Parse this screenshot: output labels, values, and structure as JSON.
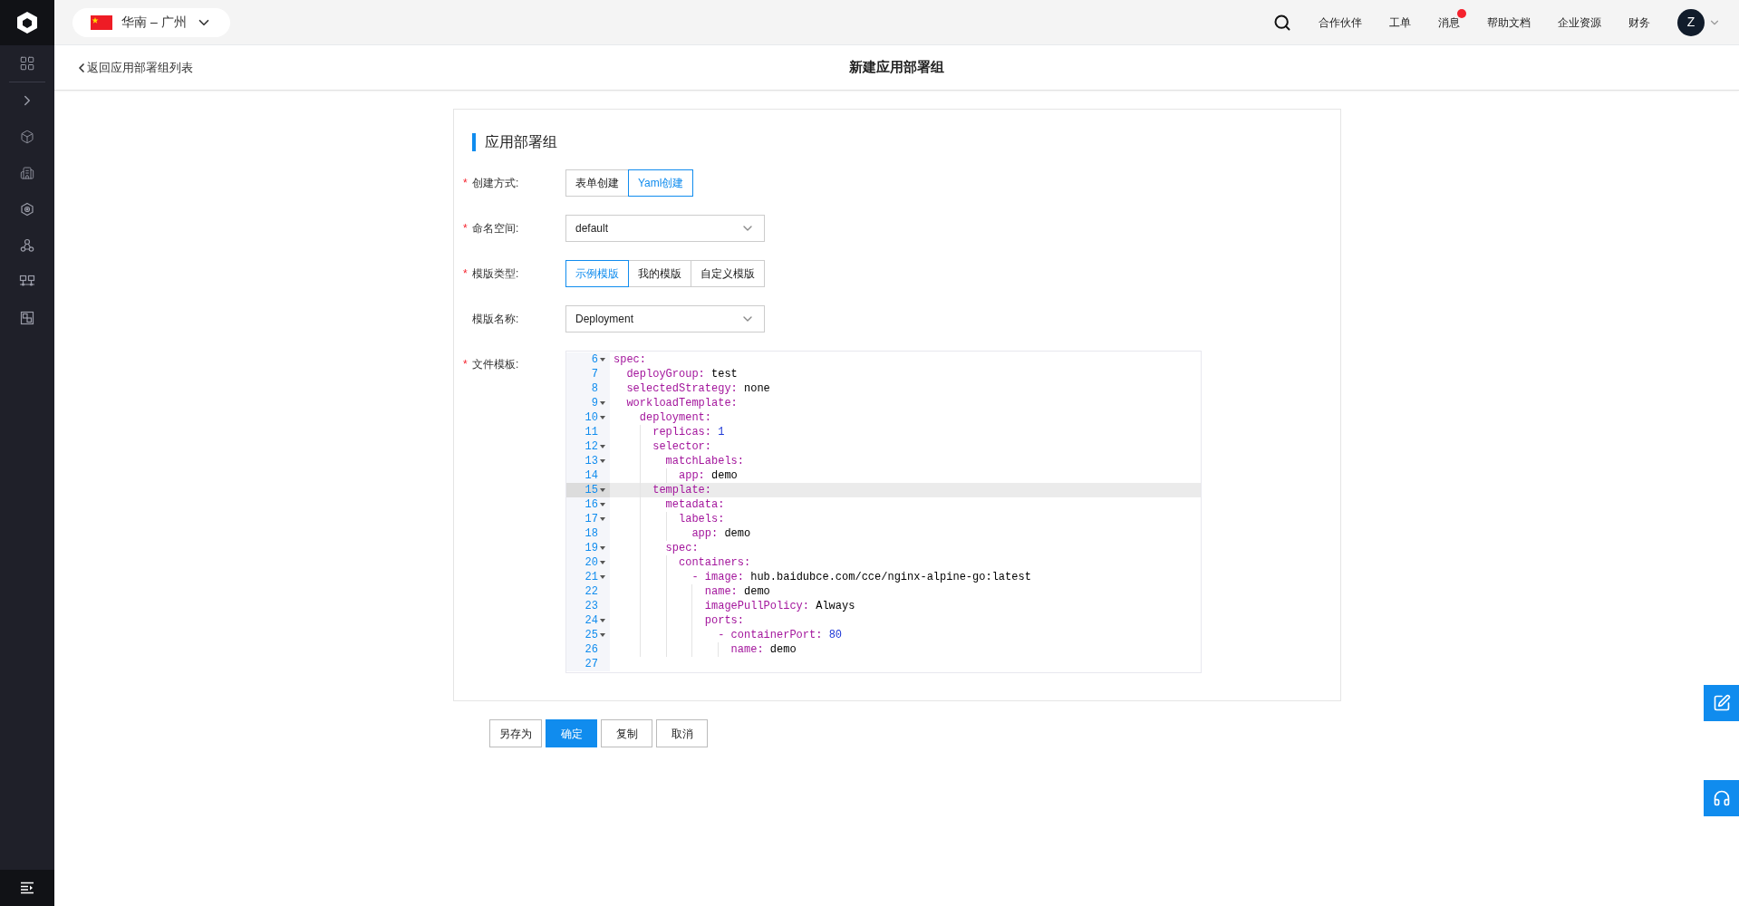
{
  "topbar": {
    "region": "华南 – 广州",
    "nav": [
      {
        "label": "合作伙伴",
        "badge": false
      },
      {
        "label": "工单",
        "badge": false
      },
      {
        "label": "消息",
        "badge": true
      },
      {
        "label": "帮助文档",
        "badge": false
      },
      {
        "label": "企业资源",
        "badge": false
      },
      {
        "label": "财务",
        "badge": false
      }
    ],
    "avatar": "Z"
  },
  "subheader": {
    "back_link": "返回应用部署组列表",
    "title": "新建应用部署组"
  },
  "card": {
    "title": "应用部署组",
    "fields": [
      {
        "kind": "segmented",
        "label": "创建方式:",
        "required_mark": "*",
        "options": [
          {
            "label": "表单创建",
            "selected": false
          },
          {
            "label": "Yaml创建",
            "selected": true
          }
        ]
      },
      {
        "kind": "select",
        "label": "命名空间:",
        "required_mark": "*",
        "value": "default"
      },
      {
        "kind": "segmented",
        "label": "模版类型:",
        "required_mark": "*",
        "options": [
          {
            "label": "示例模版",
            "selected": true
          },
          {
            "label": "我的模版",
            "selected": false
          },
          {
            "label": "自定义模版",
            "selected": false
          }
        ]
      },
      {
        "kind": "select",
        "label": "模版名称:",
        "value": "Deployment"
      },
      {
        "kind": "editor",
        "label": "文件模板:",
        "required_mark": "*",
        "lines": [
          {
            "number": "6",
            "fold": true,
            "key": "spec:",
            "children": [
              {
                "number": "7",
                "fold": false,
                "key": "deployGroup:",
                "value": "test",
                "kind": "text"
              },
              {
                "number": "8",
                "fold": false,
                "key": "selectedStrategy:",
                "value": "none",
                "kind": "text"
              },
              {
                "number": "9",
                "fold": true,
                "key": "workloadTemplate:",
                "children": [
                  {
                    "number": "10",
                    "fold": true,
                    "key": "deployment:",
                    "children": [
                      {
                        "number": "11",
                        "fold": false,
                        "key": "replicas:",
                        "value": "1",
                        "kind": "number"
                      },
                      {
                        "number": "12",
                        "fold": true,
                        "key": "selector:",
                        "children": [
                          {
                            "number": "13",
                            "fold": true,
                            "key": "matchLabels:",
                            "children": [
                              {
                                "number": "14",
                                "fold": false,
                                "key": "app:",
                                "value": "demo",
                                "kind": "text"
                              }
                            ]
                          }
                        ]
                      },
                      {
                        "number": "15",
                        "fold": true,
                        "key": "template:",
                        "active": true,
                        "children": [
                          {
                            "number": "16",
                            "fold": true,
                            "key": "metadata:",
                            "children": [
                              {
                                "number": "17",
                                "fold": true,
                                "key": "labels:",
                                "children": [
                                  {
                                    "number": "18",
                                    "fold": false,
                                    "key": "app:",
                                    "value": "demo",
                                    "kind": "text"
                                  }
                                ]
                              }
                            ]
                          },
                          {
                            "number": "19",
                            "fold": true,
                            "key": "spec:",
                            "children": [
                              {
                                "number": "20",
                                "fold": true,
                                "key": "containers:",
                                "children": [
                                  {
                                    "number": "21",
                                    "fold": true,
                                    "dash": "-",
                                    "key": "image:",
                                    "value": "hub.baidubce.com/cce/nginx-alpine-go:latest",
                                    "kind": "text",
                                    "children": [
                                      {
                                        "number": "22",
                                        "fold": false,
                                        "key": "name:",
                                        "value": "demo",
                                        "kind": "text"
                                      },
                                      {
                                        "number": "23",
                                        "fold": false,
                                        "key": "imagePullPolicy:",
                                        "value": "Always",
                                        "kind": "text"
                                      },
                                      {
                                        "number": "24",
                                        "fold": true,
                                        "key": "ports:",
                                        "children": [
                                          {
                                            "number": "25",
                                            "fold": true,
                                            "dash": "-",
                                            "key": "containerPort:",
                                            "value": "80",
                                            "kind": "number",
                                            "children": [
                                              {
                                                "number": "26",
                                                "fold": false,
                                                "key": "name:",
                                                "value": "demo",
                                                "kind": "text"
                                              }
                                            ]
                                          }
                                        ]
                                      }
                                    ]
                                  }
                                ]
                              }
                            ]
                          }
                        ]
                      }
                    ]
                  }
                ]
              }
            ]
          },
          {
            "number": "27",
            "fold": false
          }
        ]
      }
    ]
  },
  "actions": [
    {
      "label": "另存为",
      "primary": false
    },
    {
      "label": "确定",
      "primary": true
    },
    {
      "label": "复制",
      "primary": false
    },
    {
      "label": "取消",
      "primary": false
    }
  ]
}
